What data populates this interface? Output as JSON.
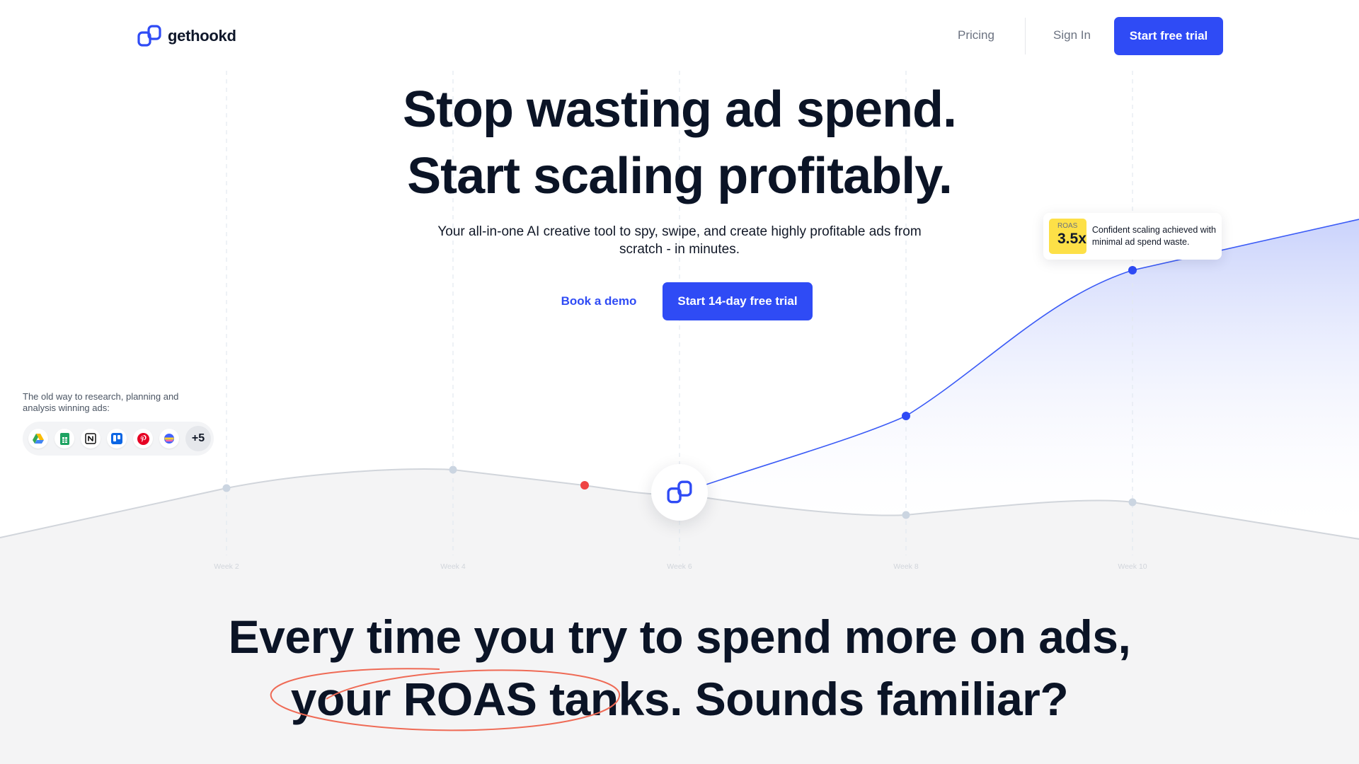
{
  "nav": {
    "brand": "gethookd",
    "pricing_label": "Pricing",
    "signin_label": "Sign In",
    "trial_label": "Start free trial"
  },
  "hero": {
    "title_line1": "Stop wasting ad spend.",
    "title_line2": "Start scaling profitably.",
    "subtitle": "Your all-in-one AI creative tool to spy, swipe, and create highly profitable ads from scratch - in minutes.",
    "demo_label": "Book a demo",
    "trial_label": "Start 14-day free trial"
  },
  "old_way": {
    "label": "The old way to research, planning and analysis winning ads:",
    "tools": [
      "google-drive-icon",
      "google-sheets-icon",
      "notion-icon",
      "trello-icon",
      "pinterest-icon",
      "miro-icon"
    ],
    "more_label": "+5"
  },
  "roas_card": {
    "label": "ROAS",
    "value": "3.5x",
    "text": "Confident scaling achieved with minimal ad spend waste."
  },
  "chart": {
    "weeks": [
      "Week 2",
      "Week 4",
      "Week 6",
      "Week 8",
      "Week 10"
    ],
    "colors": {
      "accent": "#2f4bf5",
      "alert": "#ef4444",
      "muted": "#cbd5e1"
    }
  },
  "lower": {
    "line1": "Every time you try to spend more on ads,",
    "line2_circled": "your ROAS tanks",
    "line2_rest": ". Sounds familiar?"
  }
}
